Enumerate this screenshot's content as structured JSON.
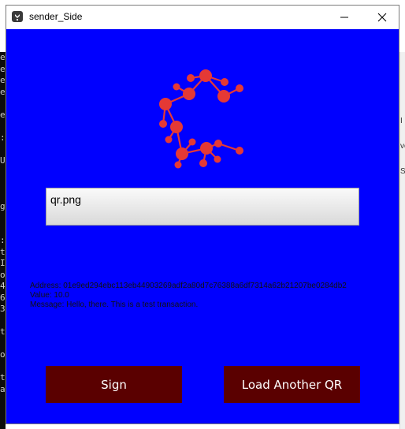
{
  "window": {
    "title": "sender_Side",
    "controls": [
      "minimize-icon",
      "maximize-icon",
      "close-icon"
    ]
  },
  "file_input": {
    "value": "qr.png"
  },
  "transaction": {
    "address_line": "Address: 01e9ed294ebc113eb44903269adf2a80d7c76388a6df7314a62b21207be0284db2",
    "value_line": "Value: 10.0",
    "message_line": "Message: Hello, there. This is a test transaction."
  },
  "buttons": {
    "sign_label": "Sign",
    "load_label": "Load Another QR"
  },
  "colors": {
    "background": "#0000ff",
    "button": "#5a0000",
    "logo": "#e53935"
  },
  "background_terminal_chars": [
    "e",
    "e",
    "e",
    "e",
    "",
    "e",
    "",
    ":",
    "",
    "U",
    "",
    "",
    "",
    "g",
    "",
    "",
    ":",
    "t",
    "I",
    "o",
    "4",
    "6",
    "3",
    "",
    "t",
    "",
    "o",
    "",
    "t",
    "a"
  ],
  "background_window_chars": [
    "",
    "",
    "",
    "",
    "",
    "I",
    "",
    "ve",
    "",
    "S"
  ]
}
